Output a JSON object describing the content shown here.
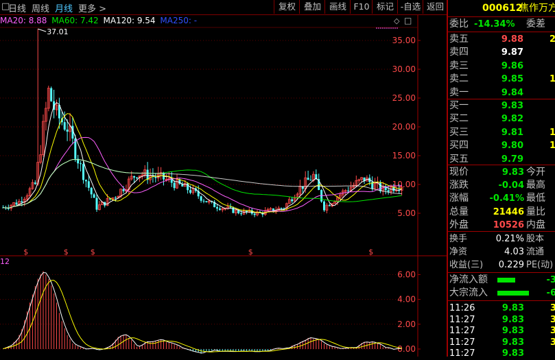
{
  "toolbar": {
    "period_tabs": [
      "日线",
      "周线",
      "月线",
      "更多 >"
    ],
    "buttons": [
      "复权",
      "叠加",
      "画线",
      "F10",
      "标记",
      "-自选",
      "返回"
    ]
  },
  "stock": {
    "code": "000612",
    "name": "焦作万方"
  },
  "ma_legend": [
    {
      "label": "MA20: 8.88",
      "color": "#ff60ff"
    },
    {
      "label": "MA60: 7.42",
      "color": "#00e600"
    },
    {
      "label": "MA120: 9.54",
      "color": "#ffffff"
    },
    {
      "label": "MA250: -",
      "color": "#3050ff"
    }
  ],
  "price_chart": {
    "y_ticks": [
      "35.00",
      "30.00",
      "25.00",
      "20.00",
      "15.00",
      "10.00",
      "5.00"
    ],
    "peak_label": "37.01",
    "dividend_marker": "$"
  },
  "indicator_chart": {
    "label": "12",
    "y_ticks": [
      "6.00",
      "4.00",
      "2.00",
      "0.00"
    ]
  },
  "orderbook": {
    "ratio_label": "委比",
    "ratio_value": "-14.34%",
    "diff_label": "委差",
    "sells": [
      {
        "label": "卖五",
        "price": "9.88",
        "vol": "2",
        "color": "#ff4a4a"
      },
      {
        "label": "卖四",
        "price": "9.87",
        "vol": "",
        "color": "#ffffff"
      },
      {
        "label": "卖三",
        "price": "9.86",
        "vol": "",
        "color": "#00e600"
      },
      {
        "label": "卖二",
        "price": "9.85",
        "vol": "1",
        "color": "#00e600"
      },
      {
        "label": "卖一",
        "price": "9.84",
        "vol": "",
        "color": "#00e600"
      }
    ],
    "buys": [
      {
        "label": "买一",
        "price": "9.83",
        "vol": "",
        "color": "#00e600"
      },
      {
        "label": "买二",
        "price": "9.82",
        "vol": "",
        "color": "#00e600"
      },
      {
        "label": "买三",
        "price": "9.81",
        "vol": "1",
        "color": "#00e600"
      },
      {
        "label": "买四",
        "price": "9.80",
        "vol": "1",
        "color": "#00e600"
      },
      {
        "label": "买五",
        "price": "9.79",
        "vol": "",
        "color": "#00e600"
      }
    ]
  },
  "quote": [
    {
      "label": "现价",
      "value": "9.83",
      "color": "#00e600",
      "label2": "今开"
    },
    {
      "label": "涨跌",
      "value": "-0.04",
      "color": "#00e600",
      "label2": "最高"
    },
    {
      "label": "涨幅",
      "value": "-0.41%",
      "color": "#00e600",
      "label2": "最低"
    },
    {
      "label": "总量",
      "value": "21446",
      "color": "#ffff00",
      "label2": "量比"
    },
    {
      "label": "外盘",
      "value": "10526",
      "color": "#ff4a4a",
      "label2": "内盘"
    }
  ],
  "fundamentals": [
    {
      "label": "换手",
      "value": "0.21%",
      "label2": "股本"
    },
    {
      "label": "净资",
      "value": "4.03",
      "label2": "流通"
    },
    {
      "label": "收益(三)",
      "value": "0.229",
      "label2": "PE(动)"
    }
  ],
  "flows": [
    {
      "label": "净流入额",
      "value": "-3",
      "bar_fraction": 0.45
    },
    {
      "label": "大宗流入",
      "value": "-6",
      "bar_fraction": 0.8
    }
  ],
  "ticks": [
    {
      "time": "11:26",
      "price": "9.83",
      "vol": "3"
    },
    {
      "time": "11:27",
      "price": "9.83",
      "vol": "3"
    },
    {
      "time": "11:27",
      "price": "9.83",
      "vol": "3"
    },
    {
      "time": "11:27",
      "price": "9.83",
      "vol": "3"
    },
    {
      "time": "11:27",
      "price": "9.83",
      "vol": ""
    }
  ]
}
